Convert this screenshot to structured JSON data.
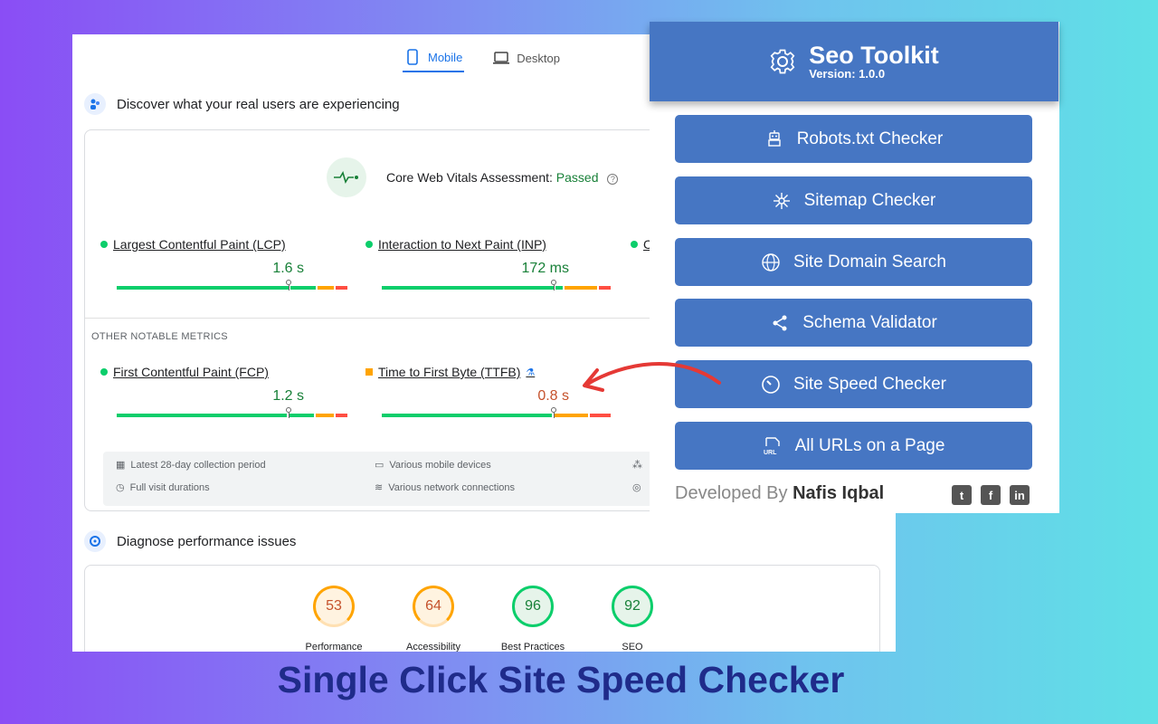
{
  "psi": {
    "tabs": [
      {
        "label": "Mobile",
        "active": true
      },
      {
        "label": "Desktop",
        "active": false
      }
    ],
    "section_users": "Discover what your real users are experiencing",
    "cwv": {
      "label": "Core Web Vitals Assessment:",
      "status": "Passed"
    },
    "metrics": [
      {
        "name": "Largest Contentful Paint (LCP)",
        "value": "1.6 s"
      },
      {
        "name": "Interaction to Next Paint (INP)",
        "value": "172 ms"
      },
      {
        "name": "First Contentful Paint (FCP)",
        "value": "1.2 s"
      },
      {
        "name": "Time to First Byte (TTFB)",
        "value": "0.8 s"
      }
    ],
    "other_metrics_label": "OTHER NOTABLE METRICS",
    "info": {
      "period": "Latest 28-day collection period",
      "devices": "Various mobile devices",
      "durations": "Full visit durations",
      "network": "Various network connections"
    },
    "section_diagnose": "Diagnose performance issues",
    "scores": [
      {
        "value": "53",
        "label": "Performance"
      },
      {
        "value": "64",
        "label": "Accessibility"
      },
      {
        "value": "96",
        "label": "Best Practices"
      },
      {
        "value": "92",
        "label": "SEO"
      }
    ]
  },
  "panel": {
    "title": "Seo Toolkit",
    "version": "Version: 1.0.0",
    "buttons": [
      {
        "label": "Robots.txt Checker",
        "icon": "robot-icon"
      },
      {
        "label": "Sitemap Checker",
        "icon": "sitemap-icon"
      },
      {
        "label": "Site Domain Search",
        "icon": "globe-icon"
      },
      {
        "label": "Schema Validator",
        "icon": "share-icon"
      },
      {
        "label": "Site Speed Checker",
        "icon": "speedometer-icon"
      },
      {
        "label": "All URLs on a Page",
        "icon": "url-icon"
      }
    ],
    "dev_prefix": "Developed By",
    "dev_name": "Nafis Iqbal"
  },
  "tagline": "Single Click Site Speed Checker",
  "colors": {
    "accent": "#4676c3",
    "good": "#0cce6b",
    "warn": "#ffa400",
    "bad": "#ff4e42",
    "arrow": "#e53935",
    "tagline": "#1f2b8a"
  }
}
